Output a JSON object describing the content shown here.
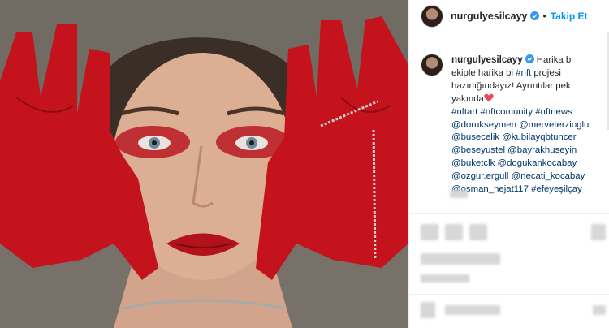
{
  "post": {
    "username": "nurgulyesilcayy",
    "verified_icon": "verified-badge-icon",
    "dot": "•",
    "follow_label": "Takip Et"
  },
  "caption": {
    "username": "nurgulyesilcayy",
    "text_part1": " Harika bi ekiple harika bi ",
    "hashtag_nft": "#nft",
    "text_part2": " projesi hazırlığındayız! Ayrıntılar pek yakında",
    "heart_icon": "red-heart-icon",
    "hashtags_line": "#nftart #nftcomunity #nftnews",
    "mentions": [
      "@dorukseymen @merveterzioglu",
      "@busecelik @kubilayqbtuncer",
      "@beseyustel @bayrakhuseyin",
      "@buketclk @dogukankocabay",
      "@ozgur.ergull @necati_kocabay",
      "@osman_nejat117 #efeyeşilçay"
    ]
  },
  "colors": {
    "accent_blue": "#0095f6",
    "link_blue": "#00376b",
    "verified_blue": "#3897f0",
    "heart_red": "#ed4956",
    "paint_red": "#c4131c"
  }
}
